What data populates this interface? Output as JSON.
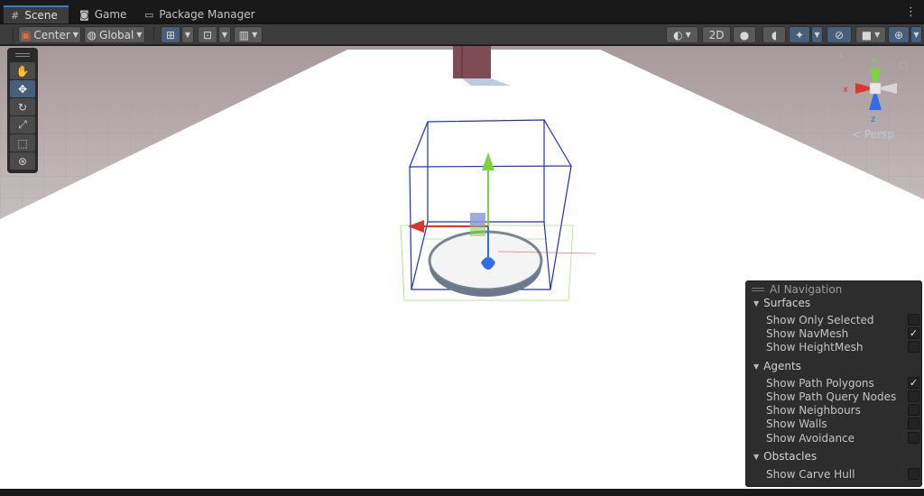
{
  "tabs": [
    {
      "label": "Scene",
      "icon": "grid-icon",
      "active": true
    },
    {
      "label": "Game",
      "icon": "gamepad-icon",
      "active": false
    },
    {
      "label": "Package Manager",
      "icon": "package-icon",
      "active": false
    }
  ],
  "toolbar": {
    "pivot_label": "Center",
    "space_label": "Global",
    "mode_2d_label": "2D"
  },
  "gizmo": {
    "projection_label": "Persp",
    "axis_x": "x",
    "axis_y": "y",
    "axis_z": "z"
  },
  "ai_navigation": {
    "title": "AI Navigation",
    "sections": [
      {
        "label": "Surfaces",
        "items": [
          {
            "label": "Show Only Selected",
            "checked": false
          },
          {
            "label": "Show NavMesh",
            "checked": true
          },
          {
            "label": "Show HeightMesh",
            "checked": false
          }
        ]
      },
      {
        "label": "Agents",
        "items": [
          {
            "label": "Show Path Polygons",
            "checked": true
          },
          {
            "label": "Show Path Query Nodes",
            "checked": false
          },
          {
            "label": "Show Neighbours",
            "checked": false
          },
          {
            "label": "Show Walls",
            "checked": false
          },
          {
            "label": "Show Avoidance",
            "checked": false
          }
        ]
      },
      {
        "label": "Obstacles",
        "items": [
          {
            "label": "Show Carve Hull",
            "checked": false
          }
        ]
      }
    ]
  },
  "colors": {
    "accent": "#3a79bb",
    "axis_x": "#e0342a",
    "axis_y": "#7ad53a",
    "axis_z": "#2f6ee8",
    "bounds": "#1d2fc9"
  }
}
